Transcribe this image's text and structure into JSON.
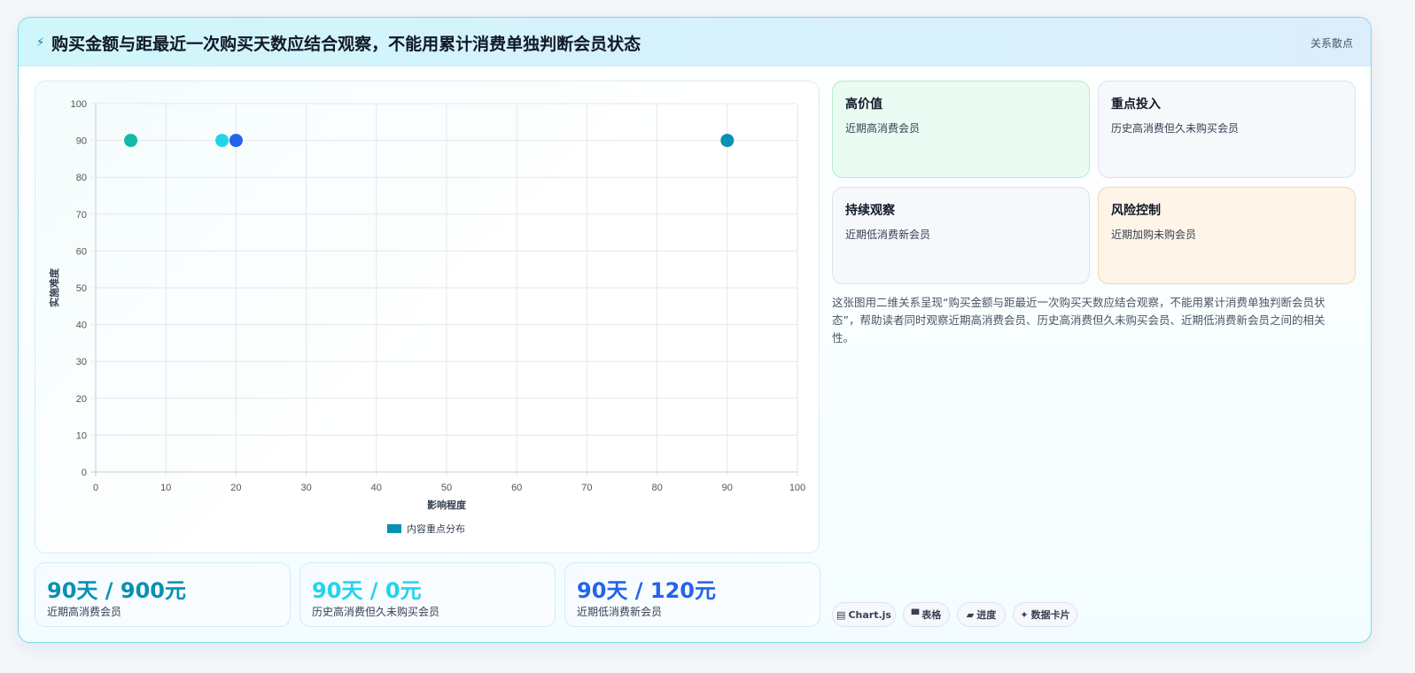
{
  "header": {
    "icon": "lightning-icon",
    "icon_glyph": "⚡",
    "title": "购买金额与距最近一次购买天数应结合观察，不能用累计消费单独判断会员状态",
    "tag": "关系散点"
  },
  "chart_data": {
    "type": "scatter",
    "xlabel": "影响程度",
    "ylabel": "实施难度",
    "xlim": [
      0,
      100
    ],
    "ylim": [
      0,
      100
    ],
    "x_ticks": [
      "0",
      "10",
      "20",
      "30",
      "40",
      "50",
      "60",
      "70",
      "80",
      "90",
      "100"
    ],
    "y_ticks": [
      "0",
      "10",
      "20",
      "30",
      "40",
      "50",
      "60",
      "70",
      "80",
      "90",
      "100"
    ],
    "grid": true,
    "legend_position": "bottom",
    "series": [
      {
        "name": "内容重点分布",
        "legend_color": "#0891b2",
        "points": [
          {
            "x": 5,
            "y": 90,
            "color": "#14b8a6"
          },
          {
            "x": 18,
            "y": 90,
            "color": "#22d3ee"
          },
          {
            "x": 20,
            "y": 90,
            "color": "#2563eb"
          },
          {
            "x": 90,
            "y": 90,
            "color": "#0891b2"
          }
        ]
      }
    ]
  },
  "stats": [
    {
      "value": "90天 / 900元",
      "label": "近期高消费会员",
      "color": "#0891b2"
    },
    {
      "value": "90天 / 0元",
      "label": "历史高消费但久未购买会员",
      "color": "#22d3ee"
    },
    {
      "value": "90天 / 120元",
      "label": "近期低消费新会员",
      "color": "#2563eb"
    }
  ],
  "quadrants": [
    {
      "title": "高价值",
      "desc": "近期高消费会员",
      "bg": "#e9fbf2",
      "border": "#b7ecd0"
    },
    {
      "title": "重点投入",
      "desc": "历史高消费但久未购买会员",
      "bg": "#f6f8fc",
      "border": "#dbe3ef"
    },
    {
      "title": "持续观察",
      "desc": "近期低消费新会员",
      "bg": "#f6f8fc",
      "border": "#dbe3ef"
    },
    {
      "title": "风险控制",
      "desc": "近期加购未购会员",
      "bg": "#fff4e8",
      "border": "#f6d5b0"
    }
  ],
  "description": "这张图用二维关系呈现“购买金额与距最近一次购买天数应结合观察，不能用累计消费单独判断会员状态”，帮助读者同时观察近期高消费会员、历史高消费但久未购买会员、近期低消费新会员之间的相关性。",
  "chips": [
    {
      "icon": "grid-icon",
      "glyph": "▤",
      "label": "Chart.js"
    },
    {
      "icon": "table-icon",
      "glyph": "▀",
      "label": "表格"
    },
    {
      "icon": "progress-icon",
      "glyph": "▰",
      "label": "进度"
    },
    {
      "icon": "sparkle-icon",
      "glyph": "✦",
      "label": "数据卡片"
    }
  ]
}
